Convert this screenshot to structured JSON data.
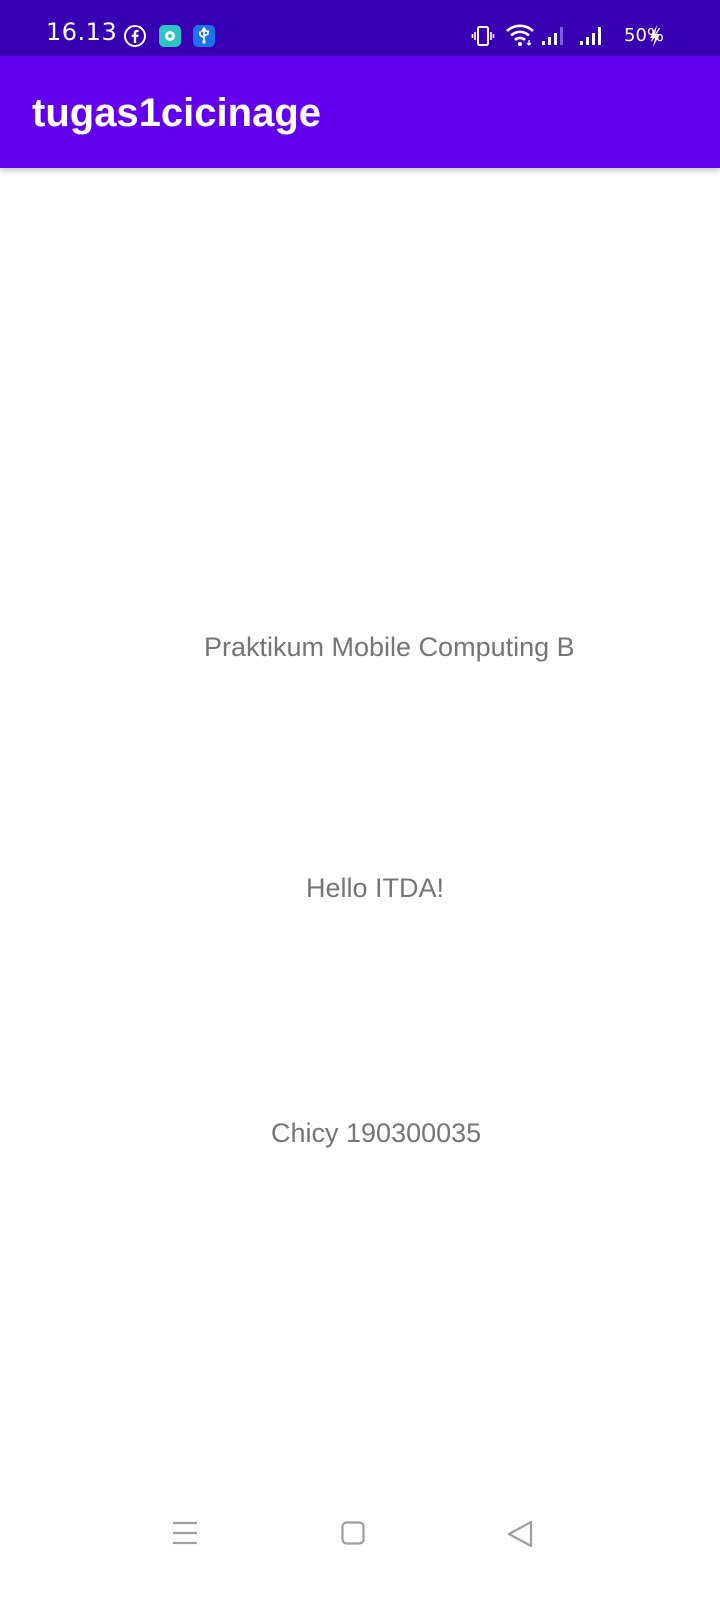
{
  "status_bar": {
    "time": "16.13",
    "battery": "50%",
    "notification_icons": [
      "facebook-icon",
      "app-notification-icon",
      "usb-icon"
    ],
    "system_icons": [
      "vibrate-icon",
      "wifi-icon",
      "signal-icon",
      "signal-icon",
      "charging-icon"
    ],
    "colors": {
      "background": "#3700b3"
    }
  },
  "app_bar": {
    "title": "tugas1cicinage",
    "colors": {
      "background": "#6200ee"
    }
  },
  "content": {
    "line1": "Praktikum Mobile Computing B",
    "line2": "Hello ITDA!",
    "line3": "Chicy 190300035"
  },
  "nav_bar": {
    "buttons": [
      "menu-icon",
      "home-icon",
      "back-icon"
    ]
  }
}
